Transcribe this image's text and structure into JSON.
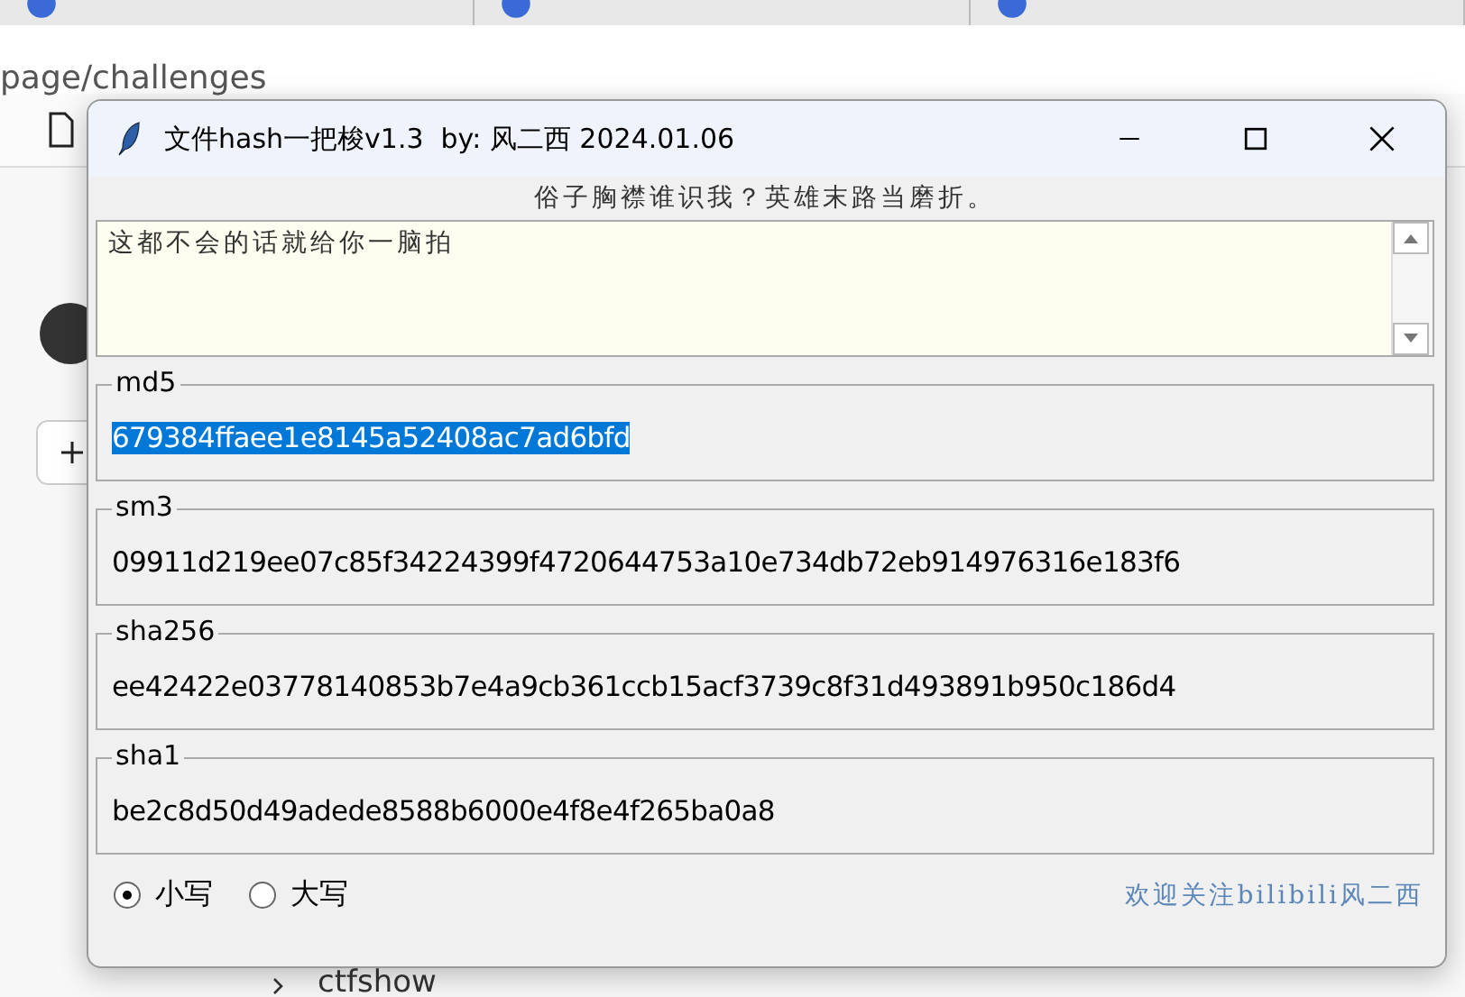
{
  "browser": {
    "address": "page/challenges",
    "tree_item": "ctfshow"
  },
  "window": {
    "title": "文件hash一把梭v1.3  by: 风二西 2024.01.06",
    "motto": "俗子胸襟谁识我？英雄末路当磨折。",
    "input_text": "这都不会的话就给你一脑拍",
    "hashes": [
      {
        "label": "md5",
        "value": "679384ffaee1e8145a52408ac7ad6bfd",
        "selected": true
      },
      {
        "label": "sm3",
        "value": "09911d219ee07c85f34224399f4720644753a10e734db72eb914976316e183f6",
        "selected": false
      },
      {
        "label": "sha256",
        "value": "ee42422e03778140853b7e4a9cb361ccb15acf3739c8f31d493891b950c186d4",
        "selected": false
      },
      {
        "label": "sha1",
        "value": "be2c8d50d49adede8588b6000e4f8e4f265ba0a8",
        "selected": false
      }
    ],
    "case_options": [
      {
        "label": "小写",
        "selected": true
      },
      {
        "label": "大写",
        "selected": false
      }
    ],
    "footer": "欢迎关注bilibili风二西"
  }
}
